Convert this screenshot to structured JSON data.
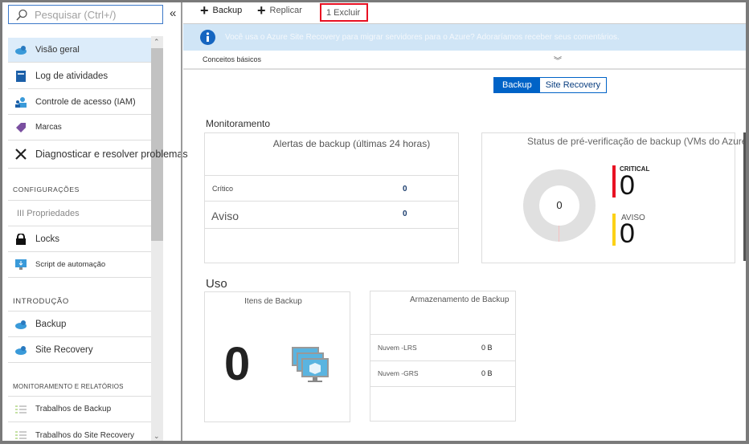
{
  "sidebar": {
    "search_placeholder": "Pesquisar (Ctrl+/)",
    "collapse": "«",
    "items": [
      {
        "label": "Visão geral",
        "icon": "cloud-icon"
      },
      {
        "label": "Log de atividades",
        "icon": "log-icon"
      },
      {
        "label": "Controle de acesso (IAM)",
        "icon": "users-icon"
      },
      {
        "label": "Marcas",
        "icon": "tag-icon"
      },
      {
        "label": "Diagnosticar e resolver problemas",
        "icon": "wrench-icon"
      }
    ],
    "sections": [
      {
        "title": "CONFIGURAÇÕES",
        "items": [
          {
            "label": "III Propriedades"
          },
          {
            "label": "Locks",
            "icon": "lock-icon"
          },
          {
            "label": "Script de automação",
            "icon": "monitor-icon"
          }
        ]
      },
      {
        "title": "INTRODUÇÃO",
        "items": [
          {
            "label": "Backup",
            "icon": "cloud-icon"
          },
          {
            "label": "Site Recovery",
            "icon": "cloud-icon"
          }
        ]
      },
      {
        "title": "MONITORAMENTO E RELATÓRIOS",
        "items": [
          {
            "label": "Trabalhos de Backup",
            "icon": "list-icon"
          },
          {
            "label": "Trabalhos do Site Recovery",
            "icon": "list-icon"
          }
        ]
      }
    ]
  },
  "toolbar": {
    "backup": "Backup",
    "replicar": "Replicar",
    "excluir": "1 Excluir"
  },
  "banner": {
    "text": "Você usa o Azure Site Recovery para migrar servidores para o Azure? Adoraríamos receber seus comentários."
  },
  "essentials": {
    "label": "Conceitos básicos"
  },
  "toggle": {
    "backup": "Backup",
    "site_recovery": "Site Recovery"
  },
  "monitoring": {
    "title": "Monitoramento",
    "alerts": {
      "title": "Alertas de backup (últimas 24 horas)",
      "rows": [
        {
          "label": "Crítico",
          "value": "0"
        },
        {
          "label": "Aviso",
          "value": "0"
        }
      ]
    },
    "precheck": {
      "title": "Status de pré-verificação de backup (VMs do Azure)",
      "total": "0",
      "critical_label": "CRITICAL",
      "critical_value": "0",
      "warning_label": "AVISO",
      "warning_value": "0",
      "colors": {
        "critical": "#e81123",
        "warning": "#fcd116"
      }
    }
  },
  "usage": {
    "title": "Uso",
    "items": {
      "title": "Itens de Backup",
      "value": "0"
    },
    "storage": {
      "title": "Armazenamento de Backup",
      "rows": [
        {
          "label": "Nuvem -LRS",
          "value": "0 B"
        },
        {
          "label": "Nuvem -GRS",
          "value": "0 B"
        }
      ]
    }
  }
}
